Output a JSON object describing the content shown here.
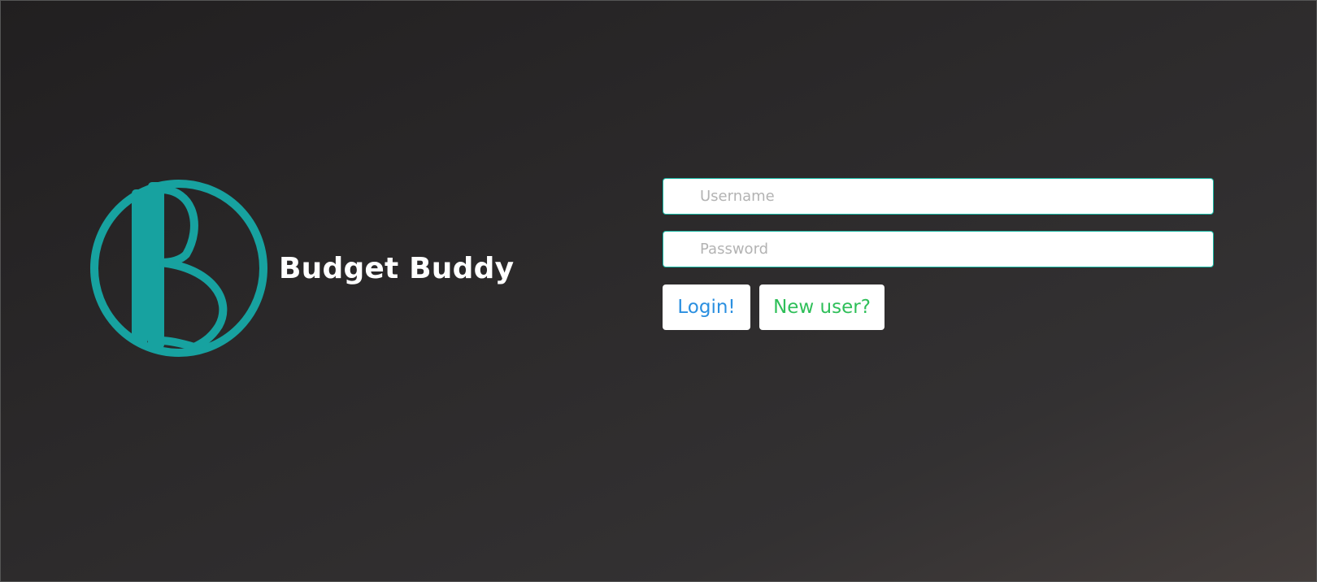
{
  "app": {
    "title": "Budget Buddy",
    "logo_icon": "bb-monogram-logo",
    "brand_color": "#17a2a0"
  },
  "login": {
    "username_placeholder": "Username",
    "password_placeholder": "Password",
    "login_label": "Login!",
    "new_user_label": "New user?"
  },
  "colors": {
    "field_border": "#17b8a4",
    "login_text": "#2a8fe0",
    "new_user_text": "#2fbf59"
  }
}
